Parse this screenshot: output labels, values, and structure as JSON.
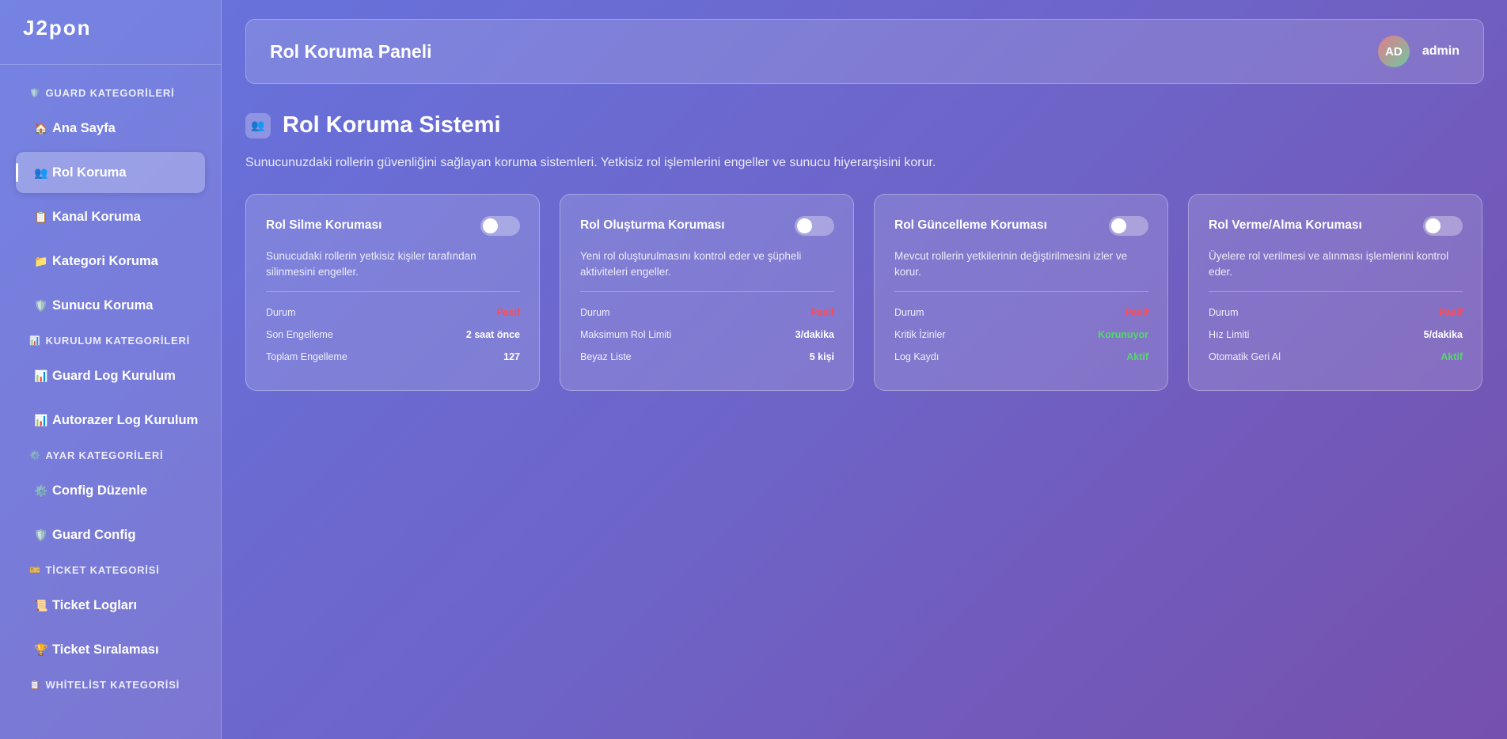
{
  "brand": "J2pon",
  "sidebar": {
    "groups": [
      {
        "title": "GUARD KATEGORİLERİ",
        "icon": "🛡️",
        "items": [
          {
            "label": "Ana Sayfa",
            "icon": "🏠",
            "active": false
          },
          {
            "label": "Rol Koruma",
            "icon": "👥",
            "active": true
          },
          {
            "label": "Kanal Koruma",
            "icon": "📋",
            "active": false
          },
          {
            "label": "Kategori Koruma",
            "icon": "📁",
            "active": false
          },
          {
            "label": "Sunucu Koruma",
            "icon": "🛡️",
            "active": false
          }
        ]
      },
      {
        "title": "KURULUM KATEGORİLERİ",
        "icon": "📊",
        "items": [
          {
            "label": "Guard Log Kurulum",
            "icon": "📊",
            "active": false
          },
          {
            "label": "Autorazer Log Kurulum",
            "icon": "📊",
            "active": false
          }
        ]
      },
      {
        "title": "AYAR KATEGORİLERİ",
        "icon": "⚙️",
        "items": [
          {
            "label": "Config Düzenle",
            "icon": "⚙️",
            "active": false
          },
          {
            "label": "Guard Config",
            "icon": "🛡️",
            "active": false
          }
        ]
      },
      {
        "title": "TİCKET KATEGORİSİ",
        "icon": "🎫",
        "items": [
          {
            "label": "Ticket Logları",
            "icon": "📜",
            "active": false
          },
          {
            "label": "Ticket Sıralaması",
            "icon": "🏆",
            "active": false
          }
        ]
      },
      {
        "title": "WHİTELİST KATEGORİSİ",
        "icon": "📋",
        "items": []
      }
    ]
  },
  "header": {
    "title": "Rol Koruma Paneli",
    "avatar_initials": "AD",
    "username": "admin"
  },
  "section": {
    "icon": "👥",
    "title": "Rol Koruma Sistemi",
    "description": "Sunucunuzdaki rollerin güvenliğini sağlayan koruma sistemleri. Yetkisiz rol işlemlerini engeller ve sunucu hiyerarşisini korur."
  },
  "cards": [
    {
      "title": "Rol Silme Koruması",
      "enabled": false,
      "description": "Sunucudaki rollerin yetkisiz kişiler tarafından silinmesini engeller.",
      "stats": [
        {
          "label": "Durum",
          "value": "Pasif",
          "tone": "red"
        },
        {
          "label": "Son Engelleme",
          "value": "2 saat önce",
          "tone": "white"
        },
        {
          "label": "Toplam Engelleme",
          "value": "127",
          "tone": "white"
        }
      ]
    },
    {
      "title": "Rol Oluşturma Koruması",
      "enabled": false,
      "description": "Yeni rol oluşturulmasını kontrol eder ve şüpheli aktiviteleri engeller.",
      "stats": [
        {
          "label": "Durum",
          "value": "Pasif",
          "tone": "red"
        },
        {
          "label": "Maksimum Rol Limiti",
          "value": "3/dakika",
          "tone": "white"
        },
        {
          "label": "Beyaz Liste",
          "value": "5 kişi",
          "tone": "white"
        }
      ]
    },
    {
      "title": "Rol Güncelleme Koruması",
      "enabled": false,
      "description": "Mevcut rollerin yetkilerinin değiştirilmesini izler ve korur.",
      "stats": [
        {
          "label": "Durum",
          "value": "Pasif",
          "tone": "red"
        },
        {
          "label": "Kritik İzinler",
          "value": "Korunuyor",
          "tone": "green"
        },
        {
          "label": "Log Kaydı",
          "value": "Aktif",
          "tone": "green"
        }
      ]
    },
    {
      "title": "Rol Verme/Alma Koruması",
      "enabled": false,
      "description": "Üyelere rol verilmesi ve alınması işlemlerini kontrol eder.",
      "stats": [
        {
          "label": "Durum",
          "value": "Pasif",
          "tone": "red"
        },
        {
          "label": "Hız Limiti",
          "value": "5/dakika",
          "tone": "white"
        },
        {
          "label": "Otomatik Geri Al",
          "value": "Aktif",
          "tone": "green"
        }
      ]
    }
  ]
}
